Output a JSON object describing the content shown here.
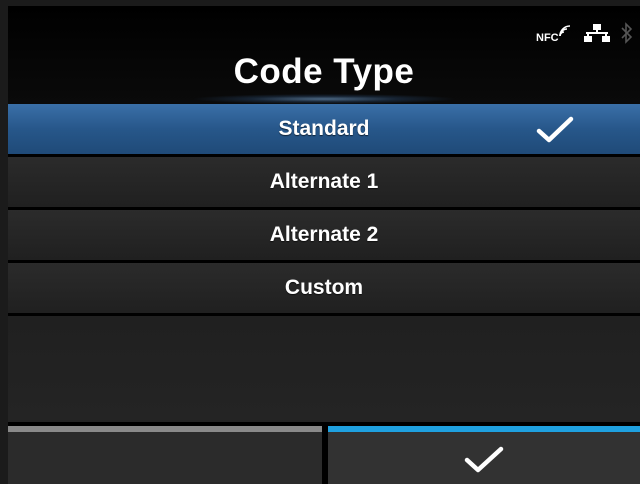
{
  "header": {
    "title": "Code Type",
    "status_icons": [
      "nfc-icon",
      "network-icon",
      "bluetooth-icon"
    ],
    "nfc_label": "NFC"
  },
  "list": {
    "items": [
      {
        "label": "Standard",
        "selected": true
      },
      {
        "label": "Alternate 1",
        "selected": false
      },
      {
        "label": "Alternate 2",
        "selected": false
      },
      {
        "label": "Custom",
        "selected": false
      }
    ]
  },
  "softkeys": {
    "left": "",
    "right_icon": "check-icon"
  },
  "colors": {
    "selected_row": "#2a5d92",
    "accent_blue": "#1fa1e0",
    "row_bg": "#262626"
  }
}
